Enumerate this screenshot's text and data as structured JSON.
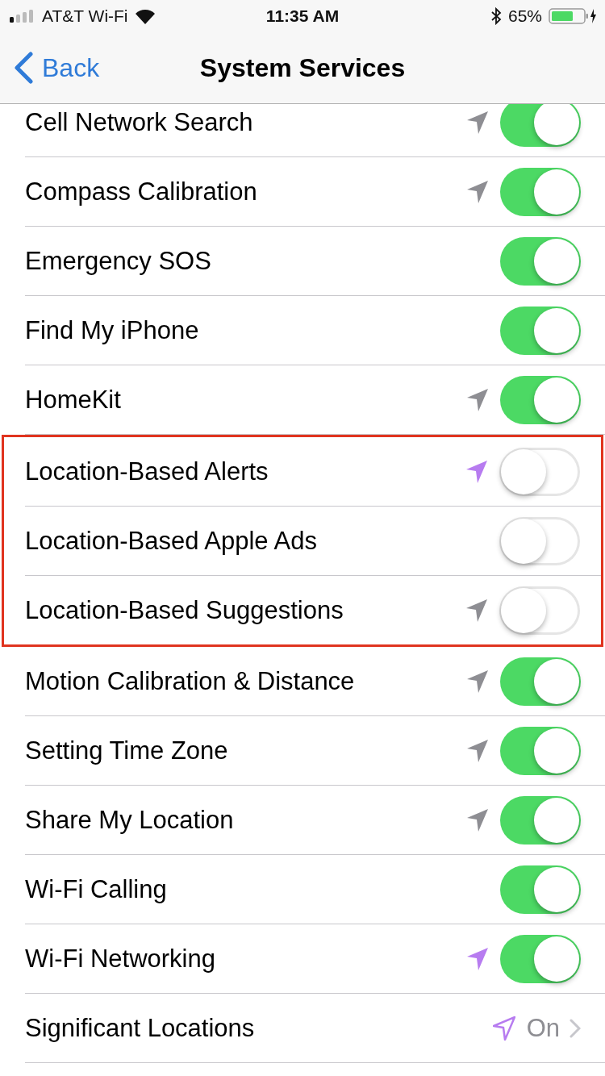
{
  "status_bar": {
    "carrier": "AT&T Wi-Fi",
    "time": "11:35 AM",
    "battery": "65%"
  },
  "nav_bar": {
    "back": "Back",
    "title": "System Services"
  },
  "groups": [
    {
      "highlighted": false,
      "rows": [
        {
          "kind": "toggle",
          "label": "Cell Network Search",
          "arrow": {
            "kind": "filled",
            "color": "#8e8e93"
          },
          "on": true
        },
        {
          "kind": "toggle",
          "label": "Compass Calibration",
          "arrow": {
            "kind": "filled",
            "color": "#8e8e93"
          },
          "on": true
        },
        {
          "kind": "toggle",
          "label": "Emergency SOS",
          "on": true
        },
        {
          "kind": "toggle",
          "label": "Find My iPhone",
          "on": true
        },
        {
          "kind": "toggle",
          "label": "HomeKit",
          "arrow": {
            "kind": "filled",
            "color": "#8e8e93"
          },
          "on": true
        }
      ]
    },
    {
      "highlighted": true,
      "rows": [
        {
          "kind": "toggle",
          "label": "Location-Based Alerts",
          "arrow": {
            "kind": "filled",
            "color": "#b77cf0"
          },
          "on": false
        },
        {
          "kind": "toggle",
          "label": "Location-Based Apple Ads",
          "on": false
        },
        {
          "kind": "toggle",
          "label": "Location-Based Suggestions",
          "arrow": {
            "kind": "filled",
            "color": "#8e8e93"
          },
          "on": false
        }
      ]
    },
    {
      "highlighted": false,
      "rows": [
        {
          "kind": "toggle",
          "label": "Motion Calibration & Distance",
          "arrow": {
            "kind": "filled",
            "color": "#8e8e93"
          },
          "on": true
        },
        {
          "kind": "toggle",
          "label": "Setting Time Zone",
          "arrow": {
            "kind": "filled",
            "color": "#8e8e93"
          },
          "on": true
        },
        {
          "kind": "toggle",
          "label": "Share My Location",
          "arrow": {
            "kind": "filled",
            "color": "#8e8e93"
          },
          "on": true
        },
        {
          "kind": "toggle",
          "label": "Wi-Fi Calling",
          "on": true
        },
        {
          "kind": "toggle",
          "label": "Wi-Fi Networking",
          "arrow": {
            "kind": "filled",
            "color": "#b77cf0"
          },
          "on": true
        },
        {
          "kind": "detail",
          "label": "Significant Locations",
          "arrow": {
            "kind": "outline",
            "color": "#b77cf0"
          },
          "value": "On"
        }
      ]
    }
  ]
}
